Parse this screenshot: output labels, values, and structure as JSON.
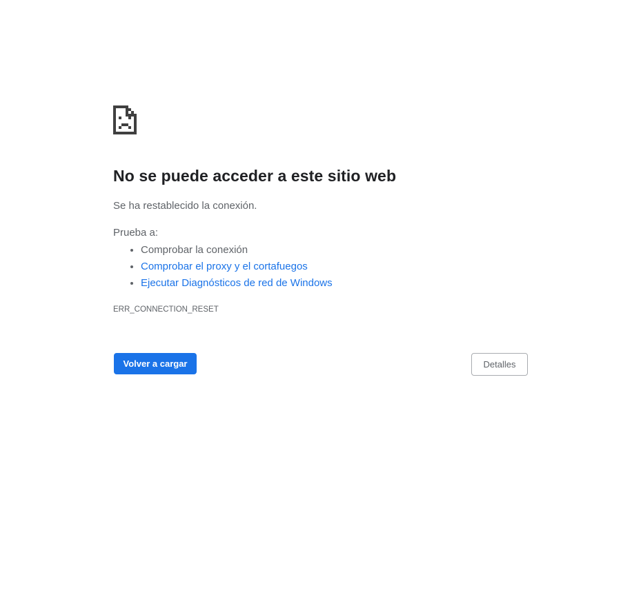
{
  "icon": {
    "name": "sad-document-icon",
    "color": "#404040"
  },
  "main": {
    "title": "No se puede acceder a este sitio web",
    "message": "Se ha restablecido la conexión.",
    "try_label": "Prueba a:",
    "suggestions": [
      {
        "label": "Comprobar la conexión",
        "is_link": false
      },
      {
        "label": "Comprobar el proxy y el cortafuegos",
        "is_link": true
      },
      {
        "label": "Ejecutar Diagnósticos de red de Windows",
        "is_link": true
      }
    ],
    "error_code": "ERR_CONNECTION_RESET"
  },
  "buttons": {
    "reload_label": "Volver a cargar",
    "details_label": "Detalles"
  },
  "colors": {
    "accent": "#1a73e8",
    "title_text": "#202124",
    "body_text": "#5f6368"
  }
}
